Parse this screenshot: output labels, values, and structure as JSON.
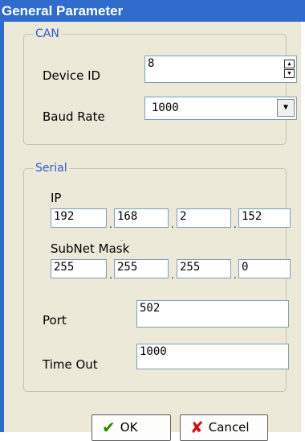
{
  "window": {
    "title": "General Parameter"
  },
  "can": {
    "caption": "CAN",
    "device_id_label": "Device ID",
    "device_id_value": "8",
    "baud_rate_label": "Baud Rate",
    "baud_rate_value": "1000"
  },
  "serial": {
    "caption": "Serial",
    "ip_label": "IP",
    "ip": [
      "192",
      "168",
      "2",
      "152"
    ],
    "subnet_label": "SubNet Mask",
    "subnet": [
      "255",
      "255",
      "255",
      "0"
    ],
    "port_label": "Port",
    "port_value": "502",
    "timeout_label": "Time Out",
    "timeout_value": "1000"
  },
  "buttons": {
    "ok_label": "OK",
    "cancel_label": "Cancel"
  },
  "icons": {
    "ok": "checkmark-icon",
    "cancel": "x-icon",
    "spin_up": "triangle-up-icon",
    "spin_down": "triangle-down-icon",
    "dropdown": "triangle-down-icon"
  },
  "colors": {
    "title_bar": "#2f6cce",
    "dialog_face": "#ece9d8",
    "group_caption": "#2d5bd0",
    "ok_check": "#2e8b00",
    "cancel_x": "#d01010"
  }
}
